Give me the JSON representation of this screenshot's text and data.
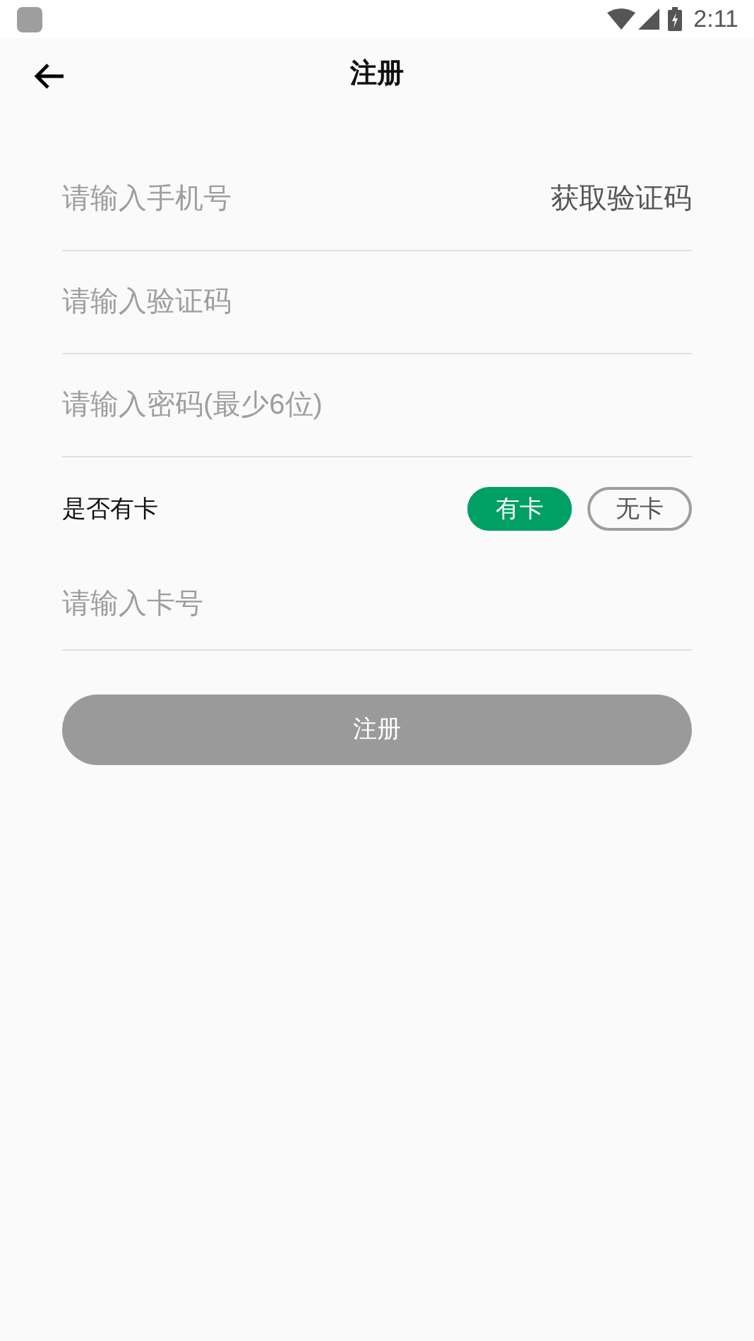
{
  "status_bar": {
    "time": "2:11"
  },
  "app_bar": {
    "title": "注册"
  },
  "fields": [
    {
      "placeholder": "请输入手机号",
      "action": "获取验证码"
    },
    {
      "placeholder": "请输入验证码"
    },
    {
      "placeholder": "请输入密码(最少6位)"
    }
  ],
  "card_choice": {
    "label": "是否有卡",
    "options": [
      {
        "label": "有卡",
        "selected": true
      },
      {
        "label": "无卡",
        "selected": false
      }
    ]
  },
  "card_field": {
    "placeholder": "请输入卡号"
  },
  "submit": {
    "label": "注册",
    "disabled": true
  }
}
